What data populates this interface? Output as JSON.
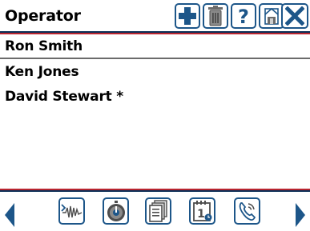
{
  "header": {
    "title": "Operator"
  },
  "toolbar": [
    {
      "name": "add-icon"
    },
    {
      "name": "trash-icon"
    },
    {
      "name": "help-icon",
      "glyph": "?"
    },
    {
      "name": "home-icon"
    },
    {
      "name": "close-icon"
    }
  ],
  "operators": [
    {
      "label": "Ron Smith",
      "selected": true
    },
    {
      "label": "Ken Jones",
      "selected": false
    },
    {
      "label": "David Stewart *",
      "selected": false
    }
  ],
  "footer": {
    "left_arrow": "left-arrow-icon",
    "right_arrow": "right-arrow-icon",
    "buttons": [
      {
        "name": "waveform-icon"
      },
      {
        "name": "stopwatch-icon"
      },
      {
        "name": "documents-icon"
      },
      {
        "name": "calendar-icon",
        "glyph": "1"
      },
      {
        "name": "phone-icon"
      }
    ]
  },
  "colors": {
    "accent_blue": "#1d5689",
    "dark_navy": "#0b2f57",
    "red_rule": "#b8252f"
  }
}
